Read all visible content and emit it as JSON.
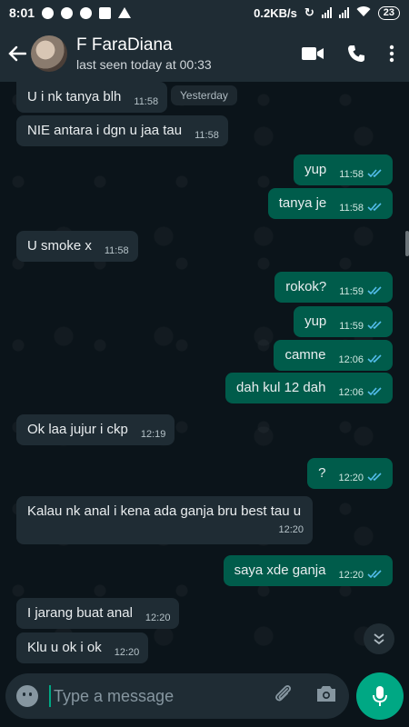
{
  "status_bar": {
    "time": "8:01",
    "net_speed": "0.2KB/s",
    "battery": "23"
  },
  "header": {
    "contact_name": "F FaraDiana",
    "last_seen": "last seen today at 00:33"
  },
  "chat": {
    "date_chip": "Yesterday",
    "messages": [
      {
        "dir": "in",
        "text": "U i nk tanya blh",
        "time": "11:58"
      },
      {
        "dir": "in",
        "text": "NIE antara i dgn u jaa tau",
        "time": "11:58"
      },
      {
        "dir": "out",
        "text": "yup",
        "time": "11:58"
      },
      {
        "dir": "out",
        "text": "tanya je",
        "time": "11:58"
      },
      {
        "dir": "in",
        "text": "U smoke x",
        "time": "11:58"
      },
      {
        "dir": "out",
        "text": "rokok?",
        "time": "11:59"
      },
      {
        "dir": "out",
        "text": "yup",
        "time": "11:59"
      },
      {
        "dir": "out",
        "text": "camne",
        "time": "12:06"
      },
      {
        "dir": "out",
        "text": "dah kul 12 dah",
        "time": "12:06"
      },
      {
        "dir": "in",
        "text": "Ok laa jujur i ckp",
        "time": "12:19"
      },
      {
        "dir": "out",
        "text": "?",
        "time": "12:20"
      },
      {
        "dir": "in",
        "text": "Kalau nk anal i kena ada ganja bru best tau u",
        "time": "12:20"
      },
      {
        "dir": "out",
        "text": "saya xde ganja",
        "time": "12:20"
      },
      {
        "dir": "in",
        "text": "I jarang buat anal",
        "time": "12:20"
      },
      {
        "dir": "in",
        "text": "Klu u ok i ok",
        "time": "12:20"
      }
    ]
  },
  "input": {
    "placeholder": "Type a message"
  },
  "colors": {
    "header": "#1f2c34",
    "outgoing": "#005c4b",
    "incoming": "#1f2c34",
    "accent": "#00a884",
    "read_ticks": "#53bdeb"
  },
  "icons": [
    "back-arrow-icon",
    "video-call-icon",
    "phone-icon",
    "more-options-icon",
    "emoji-icon",
    "attach-icon",
    "camera-icon",
    "mic-icon",
    "scroll-down-icon"
  ]
}
